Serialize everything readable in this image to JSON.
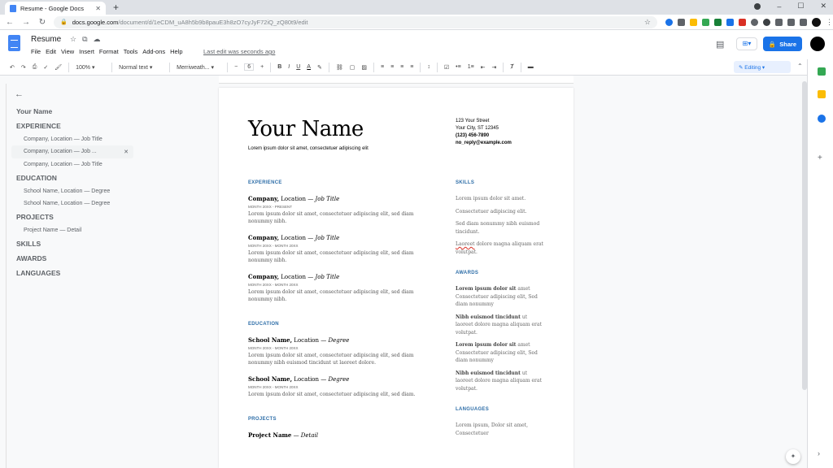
{
  "browser": {
    "tab_title": "Resume - Google Docs",
    "tab_close": "✕",
    "new_tab": "+",
    "url_host": "docs.google.com",
    "url_path": "/document/d/1eCDM_uA8h5b9b8pauE3h8zO7cyJyF72iQ_zQ80t9/edit",
    "lock": "🔒",
    "star": "☆",
    "back": "←",
    "forward": "→",
    "reload": "↻",
    "kebab": "⋮",
    "min": "–",
    "max": "☐",
    "close": "✕"
  },
  "doc": {
    "title": "Resume",
    "menus": [
      "File",
      "Edit",
      "View",
      "Insert",
      "Format",
      "Tools",
      "Add-ons",
      "Help"
    ],
    "last_edit": "Last edit was seconds ago",
    "share_label": "Share",
    "meet_label": "⊞▾",
    "comment_icon": "▤"
  },
  "toolbar": {
    "zoom": "100% ▾",
    "style": "Normal text ▾",
    "font": "Merriweath... ▾",
    "size_minus": "−",
    "size": "6",
    "size_plus": "+",
    "bold": "B",
    "italic": "I",
    "underline": "U",
    "text_color": "A",
    "editing": "✎  Editing ▾",
    "collapse": "⌃"
  },
  "outline": {
    "back": "←",
    "items": [
      {
        "label": "Your Name",
        "level": 1
      },
      {
        "label": "EXPERIENCE",
        "level": 1
      },
      {
        "label": "Company, Location — Job Title",
        "level": 2
      },
      {
        "label": "Company, Location — Job ...",
        "level": 2,
        "selected": true
      },
      {
        "label": "Company, Location — Job Title",
        "level": 2
      },
      {
        "label": "EDUCATION",
        "level": 1
      },
      {
        "label": "School Name, Location — Degree",
        "level": 2
      },
      {
        "label": "School Name, Location — Degree",
        "level": 2
      },
      {
        "label": "PROJECTS",
        "level": 1
      },
      {
        "label": "Project Name — Detail",
        "level": 2
      },
      {
        "label": "SKILLS",
        "level": 1
      },
      {
        "label": "AWARDS",
        "level": 1
      },
      {
        "label": "LANGUAGES",
        "level": 1
      }
    ],
    "close": "✕"
  },
  "resume": {
    "name": "Your Name",
    "tagline": "Lorem ipsum dolor sit amet, consectetuer adipiscing elit",
    "contact": [
      "123 Your Street",
      "Your City, ST 12345",
      "(123) 456-7890",
      "no_reply@example.com"
    ],
    "experience_heading": "EXPERIENCE",
    "jobs": [
      {
        "company": "Company,",
        "loc": " Location — ",
        "title": "Job Title",
        "dates": "MONTH 20XX - PRESENT",
        "desc": "Lorem ipsum dolor sit amet, consectetuer adipiscing elit, sed diam nonummy nibh."
      },
      {
        "company": "Company,",
        "loc": " Location — ",
        "title": "Job Title",
        "dates": "MONTH 20XX - MONTH 20XX",
        "desc": "Lorem ipsum dolor sit amet, consectetuer adipiscing elit, sed diam nonummy nibh."
      },
      {
        "company": "Company,",
        "loc": " Location — ",
        "title": "Job Title",
        "dates": "MONTH 20XX - MONTH 20XX",
        "desc": "Lorem ipsum dolor sit amet, consectetuer adipiscing elit, sed diam nonummy nibh."
      }
    ],
    "education_heading": "EDUCATION",
    "schools": [
      {
        "company": "School Name,",
        "loc": " Location — ",
        "title": "Degree",
        "dates": "MONTH 20XX - MONTH 20XX",
        "desc": "Lorem ipsum dolor sit amet, consectetuer adipiscing elit, sed diam nonummy nibh euismod tincidunt ut laoreet dolore."
      },
      {
        "company": "School Name,",
        "loc": " Location — ",
        "title": "Degree",
        "dates": "MONTH 20XX - MONTH 20XX",
        "desc": "Lorem ipsum dolor sit amet, consectetuer adipiscing elit, sed diam."
      }
    ],
    "projects_heading": "PROJECTS",
    "project": {
      "company": "Project Name",
      "loc": " — ",
      "title": "Detail"
    },
    "skills_heading": "SKILLS",
    "skills": [
      "Lorem ipsum dolor sit amet.",
      "Consectetuer adipiscing elit.",
      "Sed diam nonummy nibh euismod tincidunt."
    ],
    "skill4_a": "Laoreet",
    "skill4_b": " dolore magna aliquam erat volutpat.",
    "awards_heading": "AWARDS",
    "awards": [
      {
        "b": "Lorem ipsum dolor sit",
        "t": " amet Consectetuer adipiscing elit, Sed diam nonummy"
      },
      {
        "b": "Nibh euismod tincidunt",
        "t": " ut laoreet dolore magna aliquam erat volutpat."
      },
      {
        "b": "Lorem ipsum dolor sit",
        "t": " amet Consectetuer adipiscing elit, Sed diam nonummy"
      },
      {
        "b": "Nibh euismod tincidunt",
        "t": " ut laoreet dolore magna aliquam erat volutpat."
      }
    ],
    "languages_heading": "LANGUAGES",
    "languages": "Lorem ipsum, Dolor sit amet, Consectetuer"
  },
  "colors": {
    "accent": "#1a73e8",
    "heading": "#2e6ea8"
  }
}
